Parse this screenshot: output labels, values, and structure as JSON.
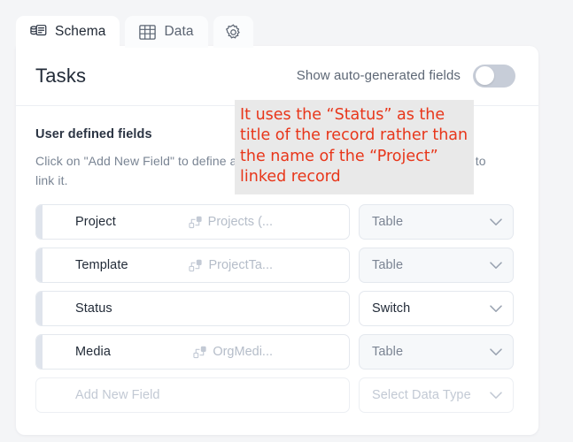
{
  "tabs": [
    {
      "label": "Schema",
      "icon": "schema-icon",
      "active": true
    },
    {
      "label": "Data",
      "icon": "table-grid-icon",
      "active": false
    },
    {
      "label": "",
      "icon": "gear-icon",
      "active": false
    }
  ],
  "header": {
    "title": "Tasks",
    "toggle_label": "Show auto-generated fields",
    "toggle_state": "off"
  },
  "body": {
    "section_title": "User defined fields",
    "section_desc": "Click on \"Add New Field\" to define a new field or drag a table from the left side to link it."
  },
  "fields": [
    {
      "name": "Project",
      "link": "Projects (...",
      "has_link": true,
      "type": "Table",
      "type_state": "disabled"
    },
    {
      "name": "Template",
      "link": "ProjectTa...",
      "has_link": true,
      "type": "Table",
      "type_state": "disabled"
    },
    {
      "name": "Status",
      "link": "",
      "has_link": false,
      "type": "Switch",
      "type_state": "enabled"
    },
    {
      "name": "Media",
      "link": "OrgMedi...",
      "has_link": true,
      "type": "Table",
      "type_state": "disabled"
    }
  ],
  "new_field": {
    "name_placeholder": "Add New Field",
    "type_placeholder": "Select Data Type"
  },
  "annotation": {
    "text": "It uses the “Status” as the title of the record rather than the name of the “Project” linked record",
    "color": "#e8361a",
    "background": "#e9e9e9"
  },
  "colors": {
    "page_background": "#f4f5f7",
    "panel": "#ffffff",
    "border": "#e4e8ee",
    "muted_text": "#7a8594",
    "toggle_track": "#c7cdd8"
  }
}
